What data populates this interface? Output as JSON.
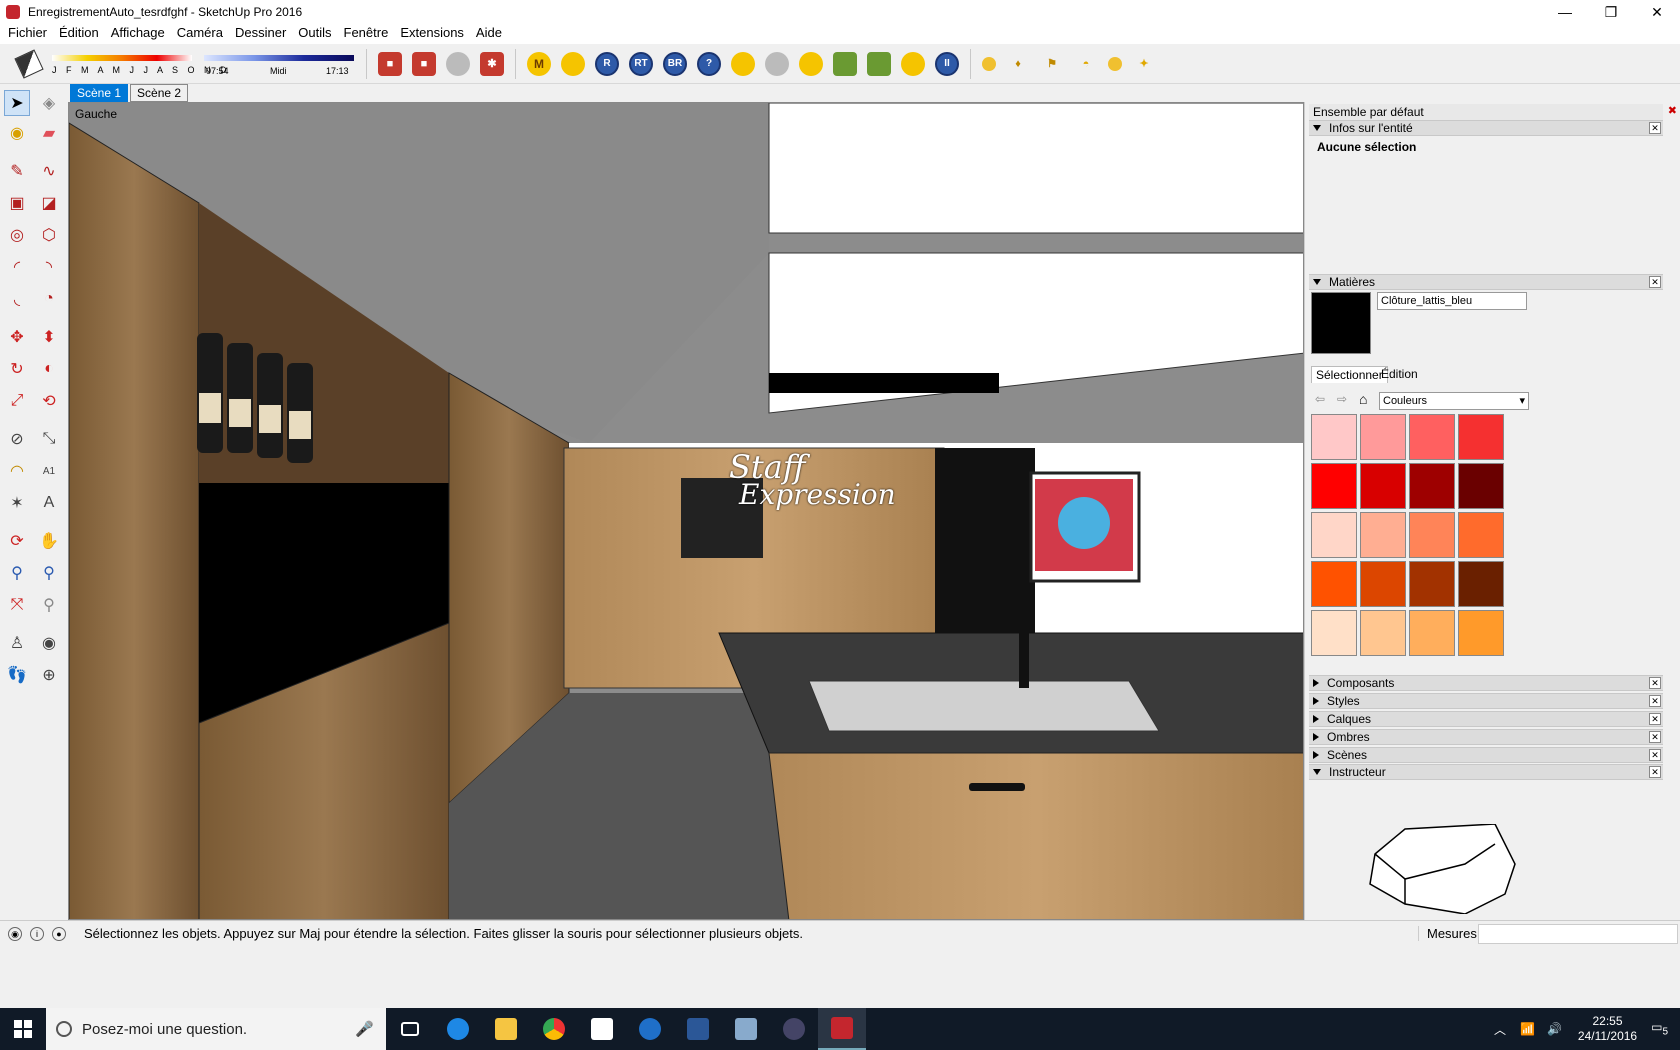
{
  "window": {
    "title": "EnregistrementAuto_tesrdfghf - SketchUp Pro 2016",
    "minimize": "—",
    "restore": "❐",
    "close": "✕"
  },
  "menu": [
    "Fichier",
    "Édition",
    "Affichage",
    "Caméra",
    "Dessiner",
    "Outils",
    "Fenêtre",
    "Extensions",
    "Aide"
  ],
  "shadow_settings": {
    "months": "J F M A M J J A S O N D",
    "time_start": "07:54",
    "time_mid": "Midi",
    "time_end": "17:13"
  },
  "toolbar_icons": [
    {
      "label": "M",
      "icon": "m-plugin-icon",
      "style": "yel"
    },
    {
      "label": "",
      "icon": "tag-icon",
      "style": "yel"
    },
    {
      "label": "R",
      "icon": "r-plugin-icon",
      "style": "blu"
    },
    {
      "label": "RT",
      "icon": "rt-plugin-icon",
      "style": "blu"
    },
    {
      "label": "BR",
      "icon": "br-plugin-icon",
      "style": "blu"
    },
    {
      "label": "?",
      "icon": "help-icon",
      "style": "blu"
    },
    {
      "label": "",
      "icon": "tag2-icon",
      "style": "yel"
    },
    {
      "label": "",
      "icon": "sphere-icon",
      "style": "grey"
    },
    {
      "label": "",
      "icon": "layers-icon",
      "style": "yel"
    },
    {
      "label": "",
      "icon": "plant-icon",
      "style": "grn"
    },
    {
      "label": "",
      "icon": "plant2-icon",
      "style": "grn"
    },
    {
      "label": "",
      "icon": "target-icon",
      "style": "yel"
    },
    {
      "label": "II",
      "icon": "pause-icon",
      "style": "blu"
    }
  ],
  "scenes": [
    "Scène 1",
    "Scène 2"
  ],
  "viewport": {
    "view_label": "Gauche",
    "watermark_line1": "Staff",
    "watermark_line2": "Expression"
  },
  "tray": {
    "title": "Ensemble par défaut",
    "entity_info": {
      "title": "Infos sur l'entité",
      "value": "Aucune sélection"
    },
    "materials": {
      "title": "Matières",
      "current_name": "Clôture_lattis_bleu",
      "tab_select": "Sélectionner",
      "tab_edit": "Édition",
      "library": "Couleurs",
      "swatches": [
        "#ffc8c8",
        "#ff9a9a",
        "#ff6060",
        "#f53030",
        "#ff0000",
        "#d80000",
        "#9e0000",
        "#6a0000",
        "#ffd6c8",
        "#ffae92",
        "#ff8458",
        "#ff6b2c",
        "#ff5200",
        "#dc4600",
        "#a23200",
        "#6a2000",
        "#ffe0c8",
        "#ffc690",
        "#ffae5c",
        "#ff9a2a"
      ]
    },
    "panels": [
      "Composants",
      "Styles",
      "Calques",
      "Ombres",
      "Scènes"
    ],
    "instructor": "Instructeur"
  },
  "status": {
    "message": "Sélectionnez les objets. Appuyez sur Maj pour étendre la sélection. Faites glisser la souris pour sélectionner plusieurs objets.",
    "measures_label": "Mesures",
    "measures_value": ""
  },
  "taskbar": {
    "search_placeholder": "Posez-moi une question.",
    "time": "22:55",
    "date": "24/11/2016",
    "notif_count": "5"
  },
  "colors": {
    "accent": "#0078d7",
    "taskbar": "#101a27"
  }
}
